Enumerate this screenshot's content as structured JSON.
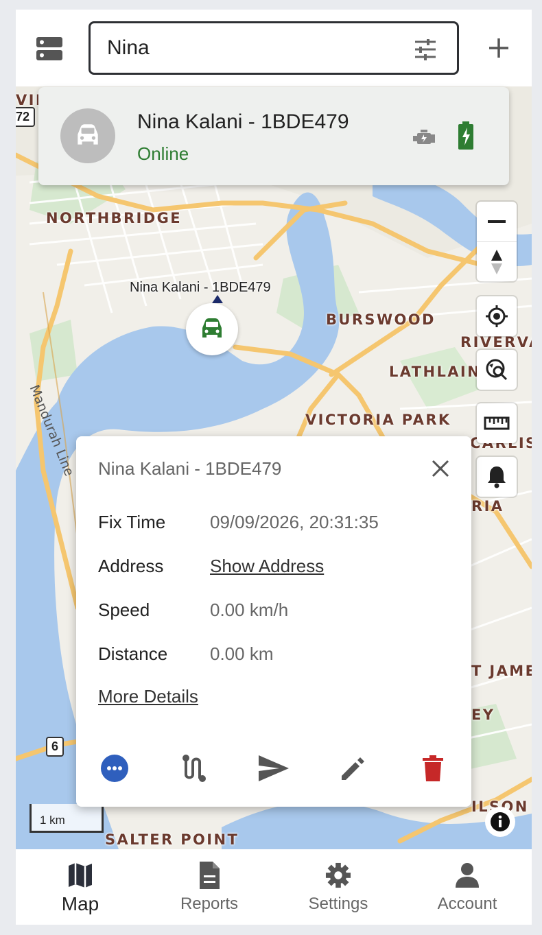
{
  "search": {
    "value": "Nina"
  },
  "device": {
    "name": "Nina Kalani - 1BDE479",
    "status": "Online",
    "status_color": "#2e7d32",
    "icon": "car-icon",
    "indicators": [
      "engine-icon",
      "battery-charging-icon"
    ]
  },
  "map": {
    "places": [
      "NORTHBRIDGE",
      "BURSWOOD",
      "RIVERVA",
      "LATHLAIN",
      "VICTORIA PARK",
      "CARLIS",
      "RIA",
      "T JAME",
      "EY",
      "ILSON",
      "SALTER POINT",
      "VIL"
    ],
    "rail_label": "Mandurah Line",
    "route_shields": [
      "72",
      "6"
    ],
    "marker_label": "Nina Kalani - 1BDE479",
    "scale_label": "1 km",
    "controls": [
      "zoom-out-icon",
      "compass-icon",
      "locate-icon",
      "follow-search-icon",
      "ruler-icon",
      "bell-icon"
    ]
  },
  "popup": {
    "title": "Nina Kalani - 1BDE479",
    "rows": [
      {
        "key": "Fix Time",
        "value": "09/09/2026, 20:31:35"
      },
      {
        "key": "Address",
        "value": "Show Address"
      },
      {
        "key": "Speed",
        "value": "0.00 km/h"
      },
      {
        "key": "Distance",
        "value": "0.00 km"
      }
    ],
    "more_details": "More Details",
    "actions": [
      "more-icon",
      "replay-icon",
      "send-command-icon",
      "edit-icon",
      "delete-icon"
    ]
  },
  "nav": [
    {
      "label": "Map",
      "icon": "map-icon",
      "active": true
    },
    {
      "label": "Reports",
      "icon": "reports-icon",
      "active": false
    },
    {
      "label": "Settings",
      "icon": "settings-icon",
      "active": false
    },
    {
      "label": "Account",
      "icon": "account-icon",
      "active": false
    }
  ],
  "colors": {
    "accent": "#2f5fbd",
    "delete": "#c62828",
    "water": "#a8c8ec",
    "road": "#f5c66f"
  }
}
